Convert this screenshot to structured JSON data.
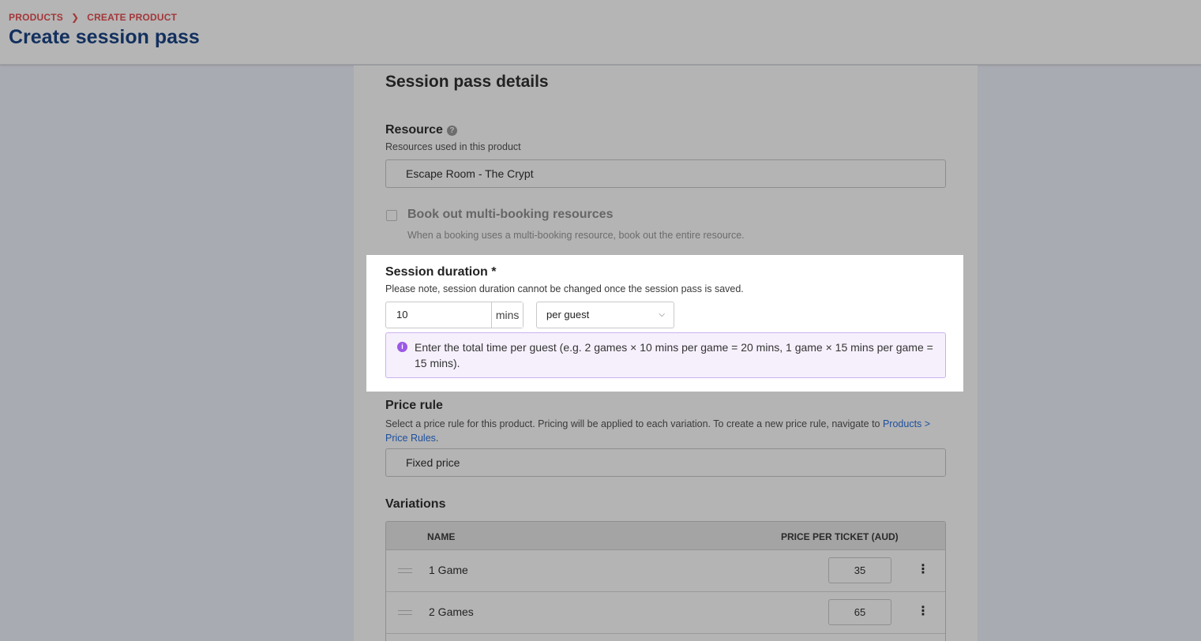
{
  "breadcrumb": {
    "items": [
      "PRODUCTS",
      "CREATE PRODUCT"
    ]
  },
  "page_title": "Create session pass",
  "section_title": "Session pass details",
  "resource": {
    "label": "Resource",
    "hint": "Resources used in this product",
    "value": "Escape Room - The Crypt"
  },
  "multi_booking": {
    "label": "Book out multi-booking resources",
    "hint": "When a booking uses a multi-booking resource, book out the entire resource."
  },
  "session_duration": {
    "label": "Session duration *",
    "hint": "Please note, session duration cannot be changed once the session pass is saved.",
    "value": "10",
    "unit": "mins",
    "per_option": "per guest",
    "info": "Enter the total time per guest (e.g. 2 games × 10 mins per game = 20 mins, 1 game × 15 mins per game = 15 mins)."
  },
  "price_rule": {
    "label": "Price rule",
    "hint_start": "Select a price rule for this product. Pricing will be applied to each variation. To create a new price rule, navigate to ",
    "hint_link_1": "Products",
    "hint_link_2": "> Price Rules",
    "hint_end": ".",
    "value": "Fixed price"
  },
  "variations": {
    "label": "Variations",
    "columns": [
      "NAME",
      "PRICE PER TICKET (AUD)"
    ],
    "rows": [
      {
        "name": "1 Game",
        "price": "35"
      },
      {
        "name": "2 Games",
        "price": "65"
      }
    ]
  }
}
